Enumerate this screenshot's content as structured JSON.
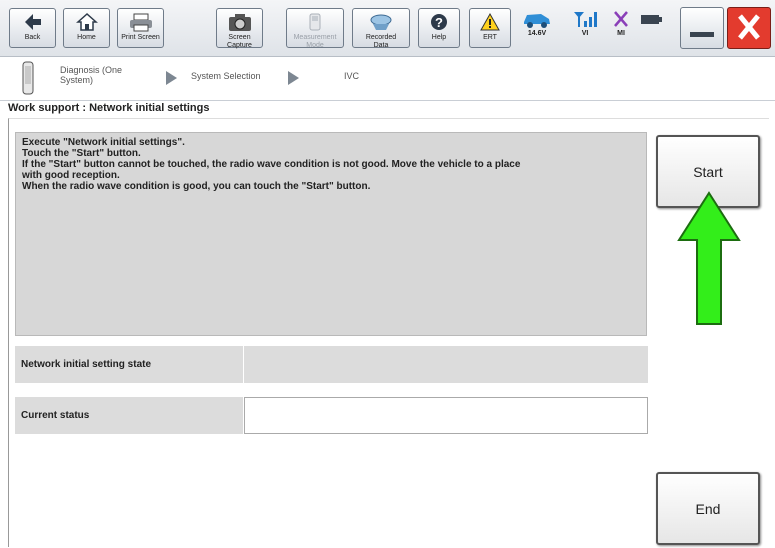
{
  "toolbar": {
    "buttons": [
      {
        "label": "Back",
        "icon": "back-arrow-icon"
      },
      {
        "label": "Home",
        "icon": "home-icon"
      },
      {
        "label": "Print Screen",
        "icon": "printer-icon"
      },
      {
        "label": "Screen\nCapture",
        "icon": "camera-icon"
      },
      {
        "label": "Measurement\nMode",
        "icon": "measurement-icon"
      },
      {
        "label": "Recorded\nData",
        "icon": "recorded-data-icon"
      },
      {
        "label": "Help",
        "icon": "help-icon"
      },
      {
        "label": "ERT",
        "icon": "warning-icon"
      }
    ],
    "status": {
      "battery_voltage": "14.6V",
      "vi_label": "VI",
      "mi_label": "MI"
    }
  },
  "breadcrumb": {
    "items": [
      "Diagnosis (One\nSystem)",
      "System Selection",
      "IVC"
    ]
  },
  "page": {
    "title": "Work support : Network initial settings"
  },
  "message": {
    "lines": [
      "Execute \"Network initial settings\".",
      "Touch the \"Start\" button.",
      "If the \"Start\" button cannot be touched, the radio wave condition is not good. Move the vehicle to a place",
      "with good reception.",
      "When the radio wave condition is good, you can touch the \"Start\" button."
    ]
  },
  "fields": {
    "network_state_label": "Network initial setting state",
    "network_state_value": "",
    "current_status_label": "Current status",
    "current_status_value": ""
  },
  "buttons": {
    "start": "Start",
    "end": "End"
  },
  "colors": {
    "arrow": "#33ee1a",
    "close": "#e33b2e"
  }
}
